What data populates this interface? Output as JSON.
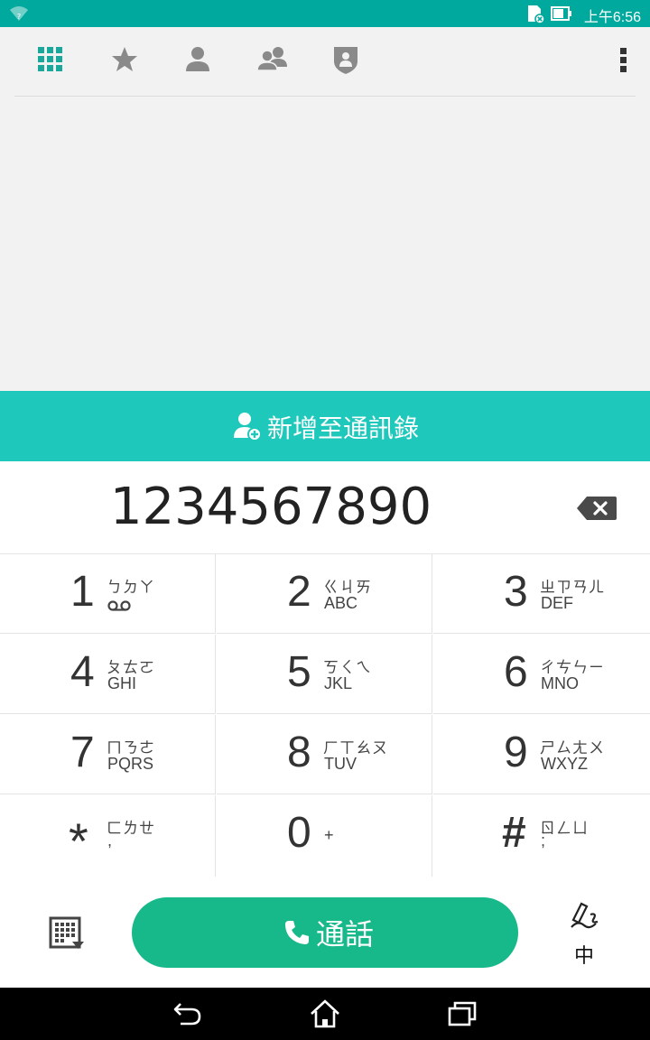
{
  "status_bar": {
    "time": "上午6:56",
    "icons": [
      "wifi-icon",
      "sd-card-icon",
      "battery-icon"
    ]
  },
  "toolbar": {
    "tabs": [
      "dialpad-tab-icon",
      "favorites-star-icon",
      "contact-person-icon",
      "groups-icon",
      "blocked-shield-icon"
    ],
    "more": "more-vert-icon",
    "accent": "#1ba89c"
  },
  "add_contact": {
    "label": "新增至通訊錄",
    "color": "#1ec8bb"
  },
  "dial_number": "1234567890",
  "keypad": [
    {
      "digit": "1",
      "zhuyin": "ㄅㄉㄚ",
      "letters": ""
    },
    {
      "digit": "2",
      "zhuyin": "ㄍㄐㄞ",
      "letters": "ABC"
    },
    {
      "digit": "3",
      "zhuyin": "ㄓㄗㄢㄦ",
      "letters": "DEF"
    },
    {
      "digit": "4",
      "zhuyin": "ㄆㄊㄛ",
      "letters": "GHI"
    },
    {
      "digit": "5",
      "zhuyin": "ㄎㄑㄟ",
      "letters": "JKL"
    },
    {
      "digit": "6",
      "zhuyin": "ㄔㄘㄣㄧ",
      "letters": "MNO"
    },
    {
      "digit": "7",
      "zhuyin": "ㄇㄋㄜ",
      "letters": "PQRS"
    },
    {
      "digit": "8",
      "zhuyin": "ㄏㄒㄠㄡ",
      "letters": "TUV"
    },
    {
      "digit": "9",
      "zhuyin": "ㄕㄙㄤㄨ",
      "letters": "WXYZ"
    },
    {
      "digit": "*",
      "zhuyin": "ㄈㄌㄝ",
      "letters": ","
    },
    {
      "digit": "0",
      "zhuyin": "",
      "letters": "+"
    },
    {
      "digit": "#",
      "zhuyin": "ㄖㄥㄩ",
      "letters": ";"
    }
  ],
  "call_button": {
    "label": "通話",
    "color": "#17b88a"
  },
  "ime": {
    "label": "中"
  },
  "nav": [
    "back-icon",
    "home-icon",
    "recents-icon"
  ]
}
